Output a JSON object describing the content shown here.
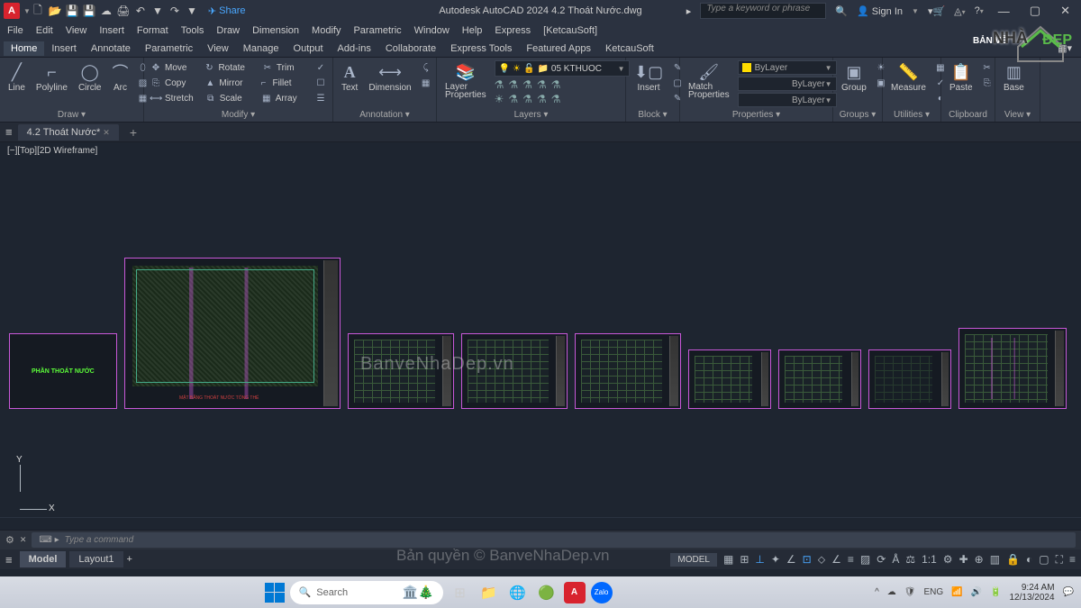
{
  "app": {
    "logo": "A",
    "title": "Autodesk AutoCAD 2024   4.2 Thoát Nước.dwg",
    "share": "Share"
  },
  "search": {
    "placeholder": "Type a keyword or phrase"
  },
  "signin": "Sign In",
  "menu": [
    "File",
    "Edit",
    "View",
    "Insert",
    "Format",
    "Tools",
    "Draw",
    "Dimension",
    "Modify",
    "Parametric",
    "Window",
    "Help",
    "Express",
    "[KetcauSoft]"
  ],
  "ribbontabs": [
    "Home",
    "Insert",
    "Annotate",
    "Parametric",
    "View",
    "Manage",
    "Output",
    "Add-ins",
    "Collaborate",
    "Express Tools",
    "Featured Apps",
    "KetcauSoft"
  ],
  "panels": {
    "draw": {
      "title": "Draw ▾",
      "items": [
        "Line",
        "Polyline",
        "Circle",
        "Arc"
      ]
    },
    "modify": {
      "title": "Modify ▾",
      "rows": [
        [
          "Move",
          "Rotate",
          "Trim"
        ],
        [
          "Copy",
          "Mirror",
          "Fillet"
        ],
        [
          "Stretch",
          "Scale",
          "Array"
        ]
      ]
    },
    "annotation": {
      "title": "Annotation ▾",
      "items": [
        "Text",
        "Dimension"
      ]
    },
    "layers": {
      "title": "Layers ▾",
      "lp": "Layer\nProperties",
      "current": "05 KTHUOC"
    },
    "block": {
      "title": "Block ▾",
      "insert": "Insert"
    },
    "properties": {
      "title": "Properties ▾",
      "match": "Match\nProperties",
      "bylayer": "ByLayer"
    },
    "groups": {
      "title": "Groups ▾",
      "group": "Group"
    },
    "utilities": {
      "title": "Utilities ▾",
      "measure": "Measure"
    },
    "clipboard": {
      "title": "Clipboard",
      "paste": "Paste"
    },
    "view": {
      "title": "View ▾",
      "base": "Base"
    }
  },
  "doctab": "4.2 Thoát Nước*",
  "viewlabel": "[−][Top][2D Wireframe]",
  "sheet0_text": "PHẦN THOÁT NƯỚC",
  "sheet1_caption": "MẶT BẰNG THOÁT NƯỚC TỔNG THỂ",
  "ucs": {
    "y": "Y",
    "x": "X"
  },
  "watermark": "BanveNhaDep.vn",
  "watermark2": "Bản quyền © BanveNhaDep.vn",
  "cmd": {
    "placeholder": "Type a command"
  },
  "layouts": {
    "model": "Model",
    "layout1": "Layout1"
  },
  "status": {
    "model": "MODEL",
    "scale": "1:1"
  },
  "taskbar": {
    "search": "Search",
    "lang": "ENG",
    "time": "9:24 AM",
    "date": "12/13/2024"
  },
  "brand": {
    "t1": "BẢN VẼ",
    "t2": "NHÀ",
    "t3": "ĐẸP"
  }
}
